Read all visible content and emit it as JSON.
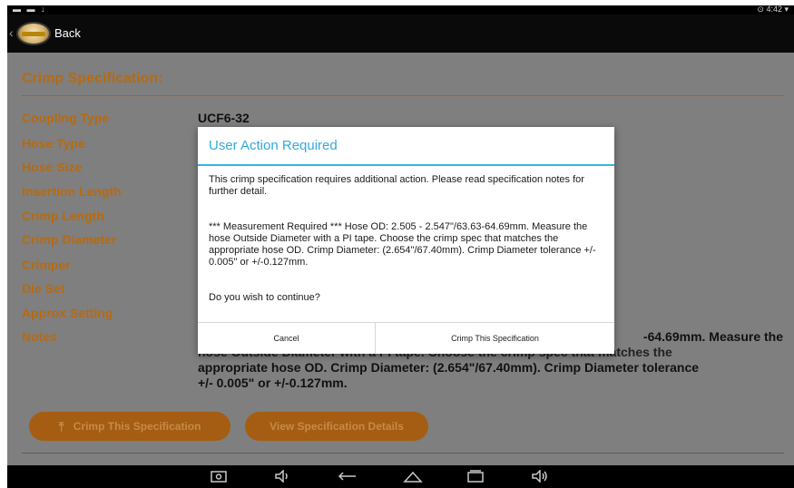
{
  "status_bar": {
    "left_icons": "▬ ▬ ↓",
    "right": "⊙ 4:42 ▾"
  },
  "action_bar": {
    "back_label": "Back",
    "logo_icon": "company-logo-icon"
  },
  "screen": {
    "title": "Crimp Specification:",
    "fields": [
      {
        "label": "Coupling Type",
        "value": "UCF6-32"
      },
      {
        "label": "Hose Type",
        "value": ""
      },
      {
        "label": "Hose Size",
        "value": ""
      },
      {
        "label": "Insertion Length",
        "value": ""
      },
      {
        "label": "Crimp Length",
        "value": ""
      },
      {
        "label": "Crimp Diameter",
        "value": ""
      },
      {
        "label": "Crimper",
        "value": ""
      },
      {
        "label": "Die Set",
        "value": ""
      },
      {
        "label": "Approx Setting",
        "value": ""
      },
      {
        "label": "Notes",
        "value": ""
      }
    ],
    "notes_line1": "-64.69mm.  Measure the",
    "notes_line2": "hose Outside Diameter with a PI tape.  Choose the crimp spec that matches the",
    "notes_line3": "appropriate hose OD.  Crimp Diameter: (2.654\"/67.40mm).   Crimp Diameter tolerance",
    "notes_line4": "+/- 0.005\" or +/-0.127mm.",
    "btn_crimp": "Crimp This Specification",
    "btn_view": "View Specification Details"
  },
  "dialog": {
    "title": "User Action Required",
    "para1": "This crimp specification requires additional action. Please read specification notes for further detail.",
    "para2": "*** Measurement Required *** Hose OD: 2.505 - 2.547\"/63.63-64.69mm.  Measure the hose Outside Diameter with a PI tape.  Choose the crimp spec that matches the appropriate hose OD.  Crimp Diameter: (2.654\"/67.40mm).   Crimp Diameter tolerance +/- 0.005\" or +/-0.127mm.",
    "question": "Do you wish to continue?",
    "cancel": "Cancel",
    "confirm": "Crimp This Specification"
  },
  "nav_bar": {
    "icons": [
      "screenshot-icon",
      "volume-down-icon",
      "back-icon",
      "home-icon",
      "recents-icon",
      "volume-up-icon"
    ]
  },
  "colors": {
    "accent": "#33b5e5",
    "brand_orange": "#b76a10"
  }
}
